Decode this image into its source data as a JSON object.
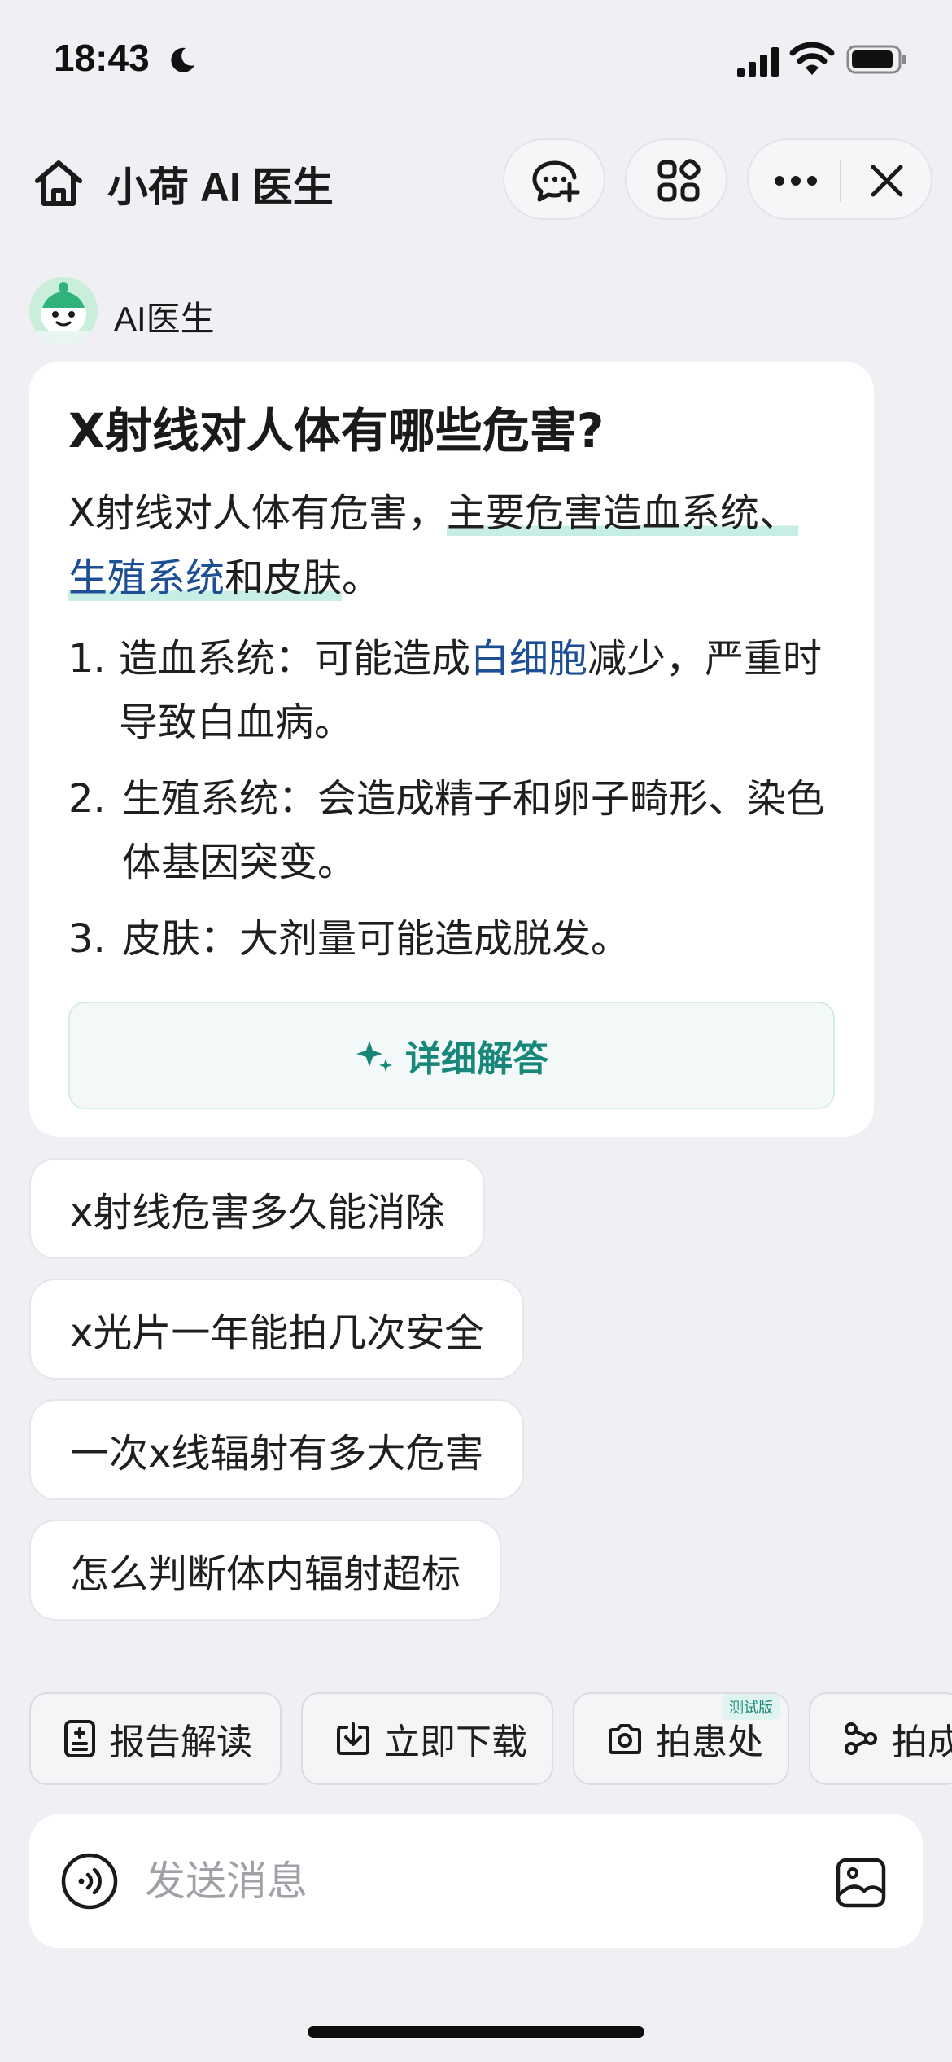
{
  "status_bar": {
    "time": "18:43"
  },
  "nav": {
    "title": "小荷 AI 医生"
  },
  "bot": {
    "name": "AI医生"
  },
  "answer": {
    "title": "X射线对人体有哪些危害?",
    "summary": {
      "prefix": "X射线对人体有危害，",
      "hl_1": "主要危害造血系统、",
      "link_1": "生殖系统",
      "hl_2": "和皮肤",
      "suffix": "。"
    },
    "list": [
      {
        "num": "1.",
        "before": "造血系统：可能造成",
        "link": "白细胞",
        "after": "减少，严重时导致白血病。"
      },
      {
        "num": "2.",
        "before": "生殖系统：会造成精子和卵子畸形、染色体基因突变。",
        "link": "",
        "after": ""
      },
      {
        "num": "3.",
        "before": "皮肤：大剂量可能造成脱发。",
        "link": "",
        "after": ""
      }
    ],
    "detail_button": "详细解答"
  },
  "suggestions": [
    "x射线危害多久能消除",
    "x光片一年能拍几次安全",
    "一次x线辐射有多大危害",
    "怎么判断体内辐射超标"
  ],
  "tools": [
    {
      "label": "报告解读",
      "icon": "report-icon"
    },
    {
      "label": "立即下载",
      "icon": "download-icon"
    },
    {
      "label": "拍患处",
      "icon": "camera-icon",
      "tag": "测试版"
    },
    {
      "label": "拍成分",
      "icon": "molecule-icon"
    }
  ],
  "input": {
    "placeholder": "发送消息"
  },
  "colors": {
    "accent": "#17877a",
    "link": "#1d4f94",
    "highlight": "#c7eee4",
    "background": "#f0f0f4"
  }
}
